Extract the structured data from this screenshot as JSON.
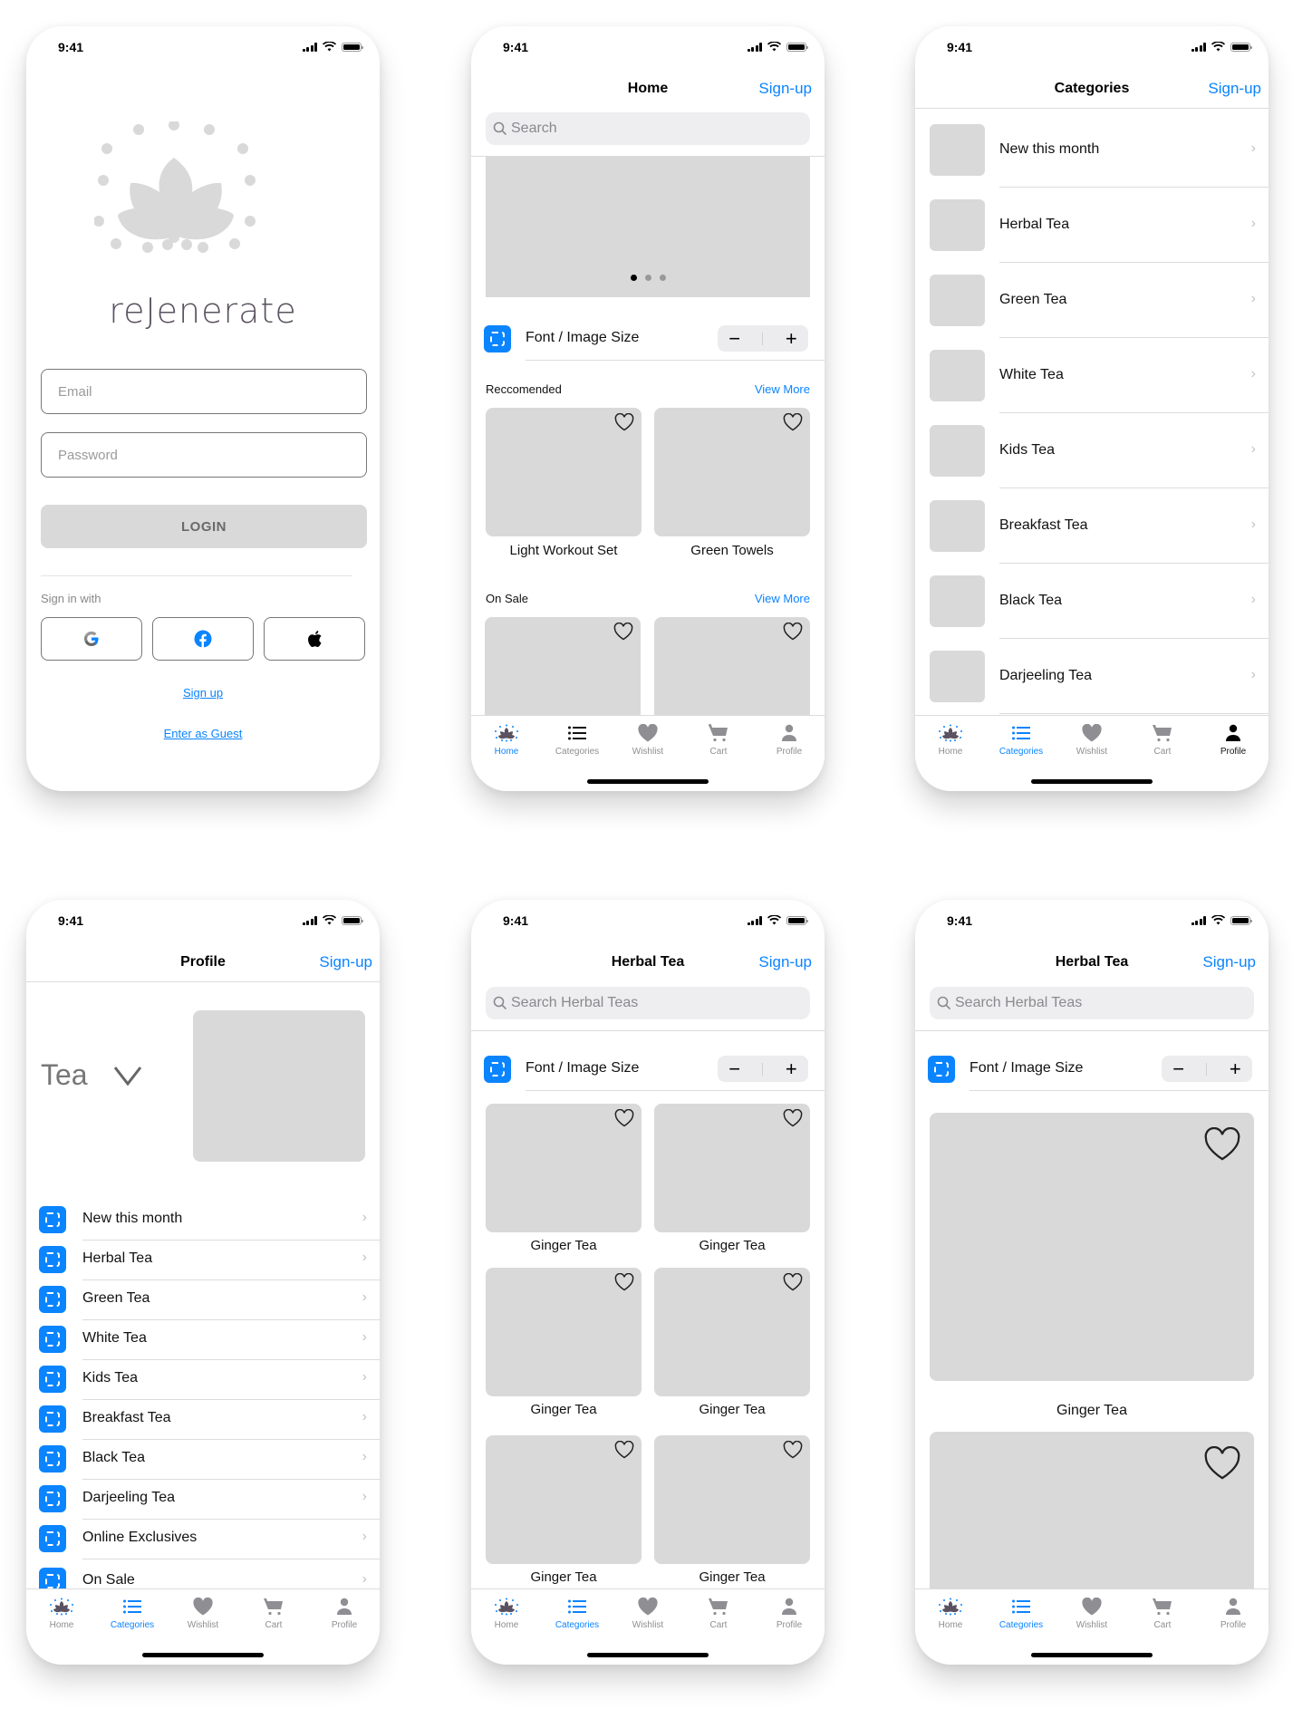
{
  "status_bar": {
    "time": "9:41"
  },
  "login": {
    "brand": "reJenerate",
    "email_placeholder": "Email",
    "password_placeholder": "Password",
    "login_label": "LOGIN",
    "sign_in_with": "Sign in with",
    "social": [
      "google-icon",
      "facebook-icon",
      "apple-icon"
    ],
    "sign_up": "Sign up",
    "guest": "Enter as Guest"
  },
  "nav": {
    "sign_up": "Sign-up"
  },
  "home": {
    "title": "Home",
    "search_placeholder": "Search",
    "carousel": {
      "pages": 3,
      "active_page": 1
    },
    "font_size_label": "Font / Image Size",
    "stepper": {
      "minus": "−",
      "plus": "+"
    },
    "recommended": {
      "title": "Reccomended",
      "view_more": "View More",
      "items": [
        "Light Workout Set",
        "Green Towels"
      ]
    },
    "on_sale": {
      "title": "On Sale",
      "view_more": "View More"
    }
  },
  "categories": {
    "title": "Categories",
    "items": [
      "New this month",
      "Herbal Tea",
      "Green Tea",
      "White Tea",
      "Kids Tea",
      "Breakfast Tea",
      "Black Tea",
      "Darjeeling Tea"
    ]
  },
  "profile": {
    "title": "Profile",
    "selector": "Tea",
    "items": [
      "New this month",
      "Herbal Tea",
      "Green Tea",
      "White Tea",
      "Kids Tea",
      "Breakfast Tea",
      "Black Tea",
      "Darjeeling Tea",
      "Online Exclusives",
      "On Sale"
    ]
  },
  "herbal": {
    "title": "Herbal Tea",
    "search_placeholder": "Search Herbal Teas",
    "font_size_label": "Font / Image Size",
    "products": [
      "Ginger Tea",
      "Ginger Tea",
      "Ginger Tea",
      "Ginger Tea",
      "Ginger Tea",
      "Ginger Tea"
    ],
    "large_products": [
      "Ginger Tea"
    ]
  },
  "tabs": [
    "Home",
    "Categories",
    "Wishlist",
    "Cart",
    "Profile"
  ],
  "colors": {
    "accent": "#0a84ff",
    "placeholder": "#d9d9d9",
    "brand_text": "#5a5260"
  }
}
